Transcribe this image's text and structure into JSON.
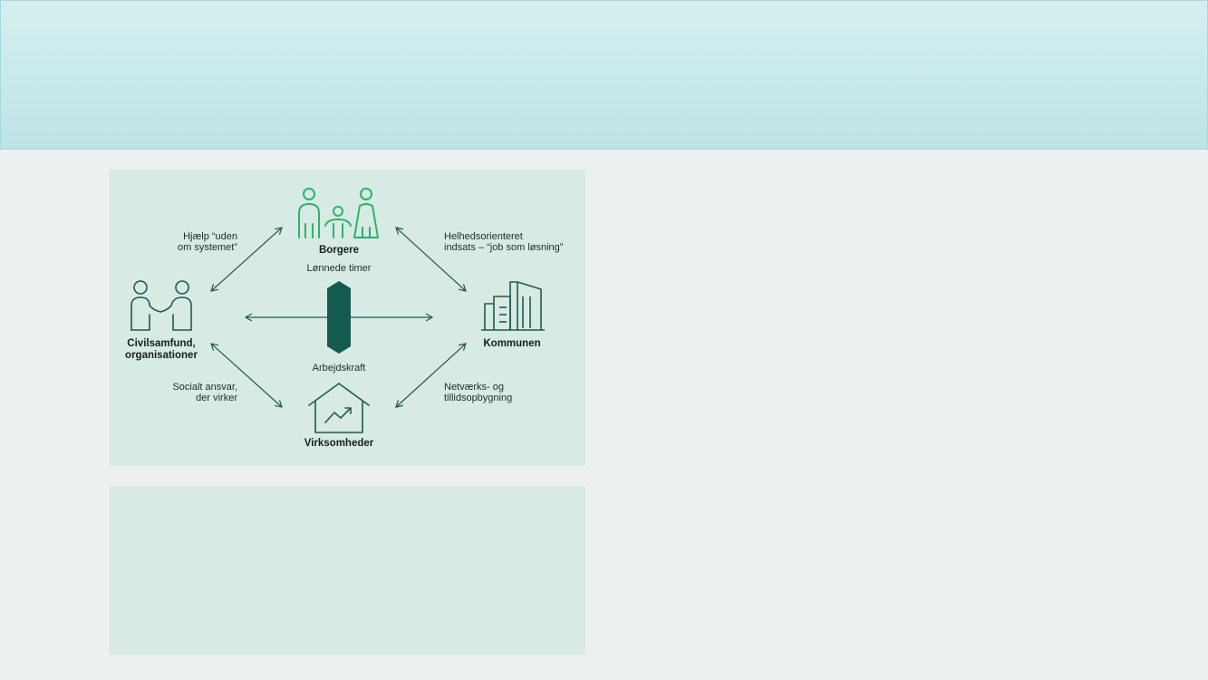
{
  "diagram": {
    "nodes": {
      "borgere": "Borgere",
      "civilsamfund_line1": "Civilsamfund,",
      "civilsamfund_line2": "organisationer",
      "kommunen": "Kommunen",
      "virksomheder": "Virksomheder"
    },
    "center": {
      "top_label": "Lønnede timer",
      "bottom_label": "Arbejdskraft"
    },
    "edges": {
      "top_left_line1": "Hjælp “uden",
      "top_left_line2": "om systemet”",
      "top_right_line1": "Helhedsorienteret",
      "top_right_line2": "indsats – “job som løsning”",
      "bottom_left_line1": "Socialt ansvar,",
      "bottom_left_line2": "der virker",
      "bottom_right_line1": "Netværks- og",
      "bottom_right_line2": "tillidsopbygning"
    },
    "icons": {
      "borgere": "family-icon",
      "civilsamfund": "two-people-icon",
      "kommunen": "buildings-icon",
      "virksomheder": "house-growth-icon",
      "center": "hexagon-bar-icon"
    },
    "colors": {
      "header": "#c9e9ea",
      "panel": "#d7eae4",
      "icon_green": "#2db36b",
      "dark_green": "#1e5b4f",
      "center_bar": "#155a4e"
    }
  }
}
